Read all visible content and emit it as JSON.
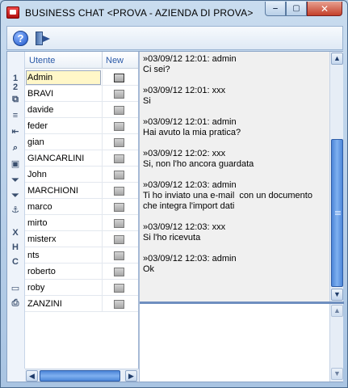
{
  "window": {
    "title": "BUSINESS CHAT <PROVA - AZIENDA DI PROVA>",
    "minimize": "‒",
    "maximize": "▢",
    "close": "✕"
  },
  "toolbar": {
    "help_icon": "help-icon",
    "help_glyph": "?",
    "exit_icon": "exit-door-icon"
  },
  "side_icons": [
    {
      "name": "page-1-icon",
      "glyph": "1"
    },
    {
      "name": "page-2-icon",
      "glyph": "2"
    },
    {
      "name": "copy-icon",
      "glyph": "⧉"
    },
    {
      "name": "list-icon",
      "glyph": "≡"
    },
    {
      "name": "import-icon",
      "glyph": "⇤"
    },
    {
      "name": "search-icon",
      "glyph": "⌕"
    },
    {
      "name": "card-icon",
      "glyph": "▣"
    },
    {
      "name": "filter-icon",
      "glyph": "⏷"
    },
    {
      "name": "filter-clear-icon",
      "glyph": "⏷"
    },
    {
      "name": "anchor-icon",
      "glyph": "⚓"
    },
    {
      "name": "export-x-icon",
      "glyph": "X"
    },
    {
      "name": "export-h-icon",
      "glyph": "H"
    },
    {
      "name": "export-c-icon",
      "glyph": "C"
    },
    {
      "name": "monitor-icon",
      "glyph": "▭"
    },
    {
      "name": "print-icon",
      "glyph": "⎙"
    }
  ],
  "grid": {
    "col_user": "Utente",
    "col_new": "New",
    "users": [
      "Admin",
      "BRAVI",
      "davide",
      "feder",
      "gian",
      "GIANCARLINI",
      "John",
      "MARCHIONI",
      "marco",
      "mirto",
      "misterx",
      "nts",
      "roberto",
      "roby",
      "ZANZINI"
    ],
    "selected": "Admin"
  },
  "chat": {
    "messages": [
      {
        "head": "»03/09/12 12:01: admin",
        "body": "Ci sei?"
      },
      {
        "head": "»03/09/12 12:01: xxx",
        "body": "Si"
      },
      {
        "head": "»03/09/12 12:01: admin",
        "body": "Hai avuto la mia pratica?"
      },
      {
        "head": "»03/09/12 12:02: xxx",
        "body": "Si, non l'ho ancora guardata"
      },
      {
        "head": "»03/09/12 12:03: admin",
        "body": "Ti ho inviato una e-mail  con un documento che integra l'import dati"
      },
      {
        "head": "»03/09/12 12:03: xxx",
        "body": "Si l'ho ricevuta"
      },
      {
        "head": "»03/09/12 12:03: admin",
        "body": "Ok"
      }
    ],
    "input_value": ""
  }
}
